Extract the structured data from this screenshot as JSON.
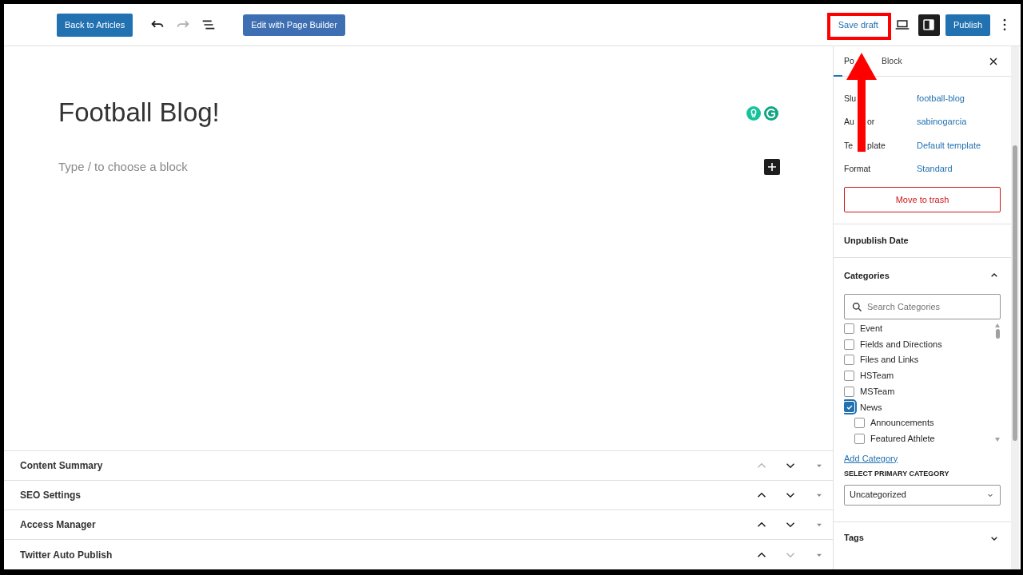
{
  "toolbar": {
    "back_button": "Back to Articles",
    "undo_enabled": true,
    "redo_enabled": false,
    "builder_button": "Edit with Page Builder",
    "save_draft": "Save draft",
    "settings_active": true,
    "publish": "Publish"
  },
  "editor": {
    "title": "Football Blog!",
    "placeholder": "Type / to choose a block"
  },
  "meta_boxes": [
    {
      "title": "Content Summary",
      "up_enabled": false,
      "down_enabled": true
    },
    {
      "title": "SEO Settings",
      "up_enabled": true,
      "down_enabled": true
    },
    {
      "title": "Access Manager",
      "up_enabled": true,
      "down_enabled": true
    },
    {
      "title": "Twitter Auto Publish",
      "up_enabled": true,
      "down_enabled": false
    }
  ],
  "sidebar": {
    "tabs": [
      {
        "label": "Po",
        "selected": true
      },
      {
        "label": "Block",
        "selected": false
      }
    ],
    "fields": [
      {
        "label": "Slu",
        "value": "football-blog"
      },
      {
        "label": "Au",
        "label_tail": "or",
        "value": "sabinogarcia"
      },
      {
        "label": "Te",
        "label_tail": "plate",
        "value": "Default template"
      },
      {
        "label": "Format",
        "value": "Standard"
      }
    ],
    "trash_button": "Move to trash",
    "unpublish_title": "Unpublish Date",
    "categories": {
      "title": "Categories",
      "expanded": true,
      "search_placeholder": "Search Categories",
      "items": [
        {
          "label": "Event",
          "checked": false
        },
        {
          "label": "Fields and Directions",
          "checked": false
        },
        {
          "label": "Files and Links",
          "checked": false
        },
        {
          "label": "HSTeam",
          "checked": false
        },
        {
          "label": "MSTeam",
          "checked": false
        },
        {
          "label": "News",
          "checked": true,
          "children": [
            {
              "label": "Announcements",
              "checked": false
            },
            {
              "label": "Featured Athlete",
              "checked": false
            }
          ]
        }
      ],
      "add_link": "Add Category",
      "primary_label": "SELECT PRIMARY CATEGORY",
      "primary_value": "Uncategorized"
    },
    "tags": {
      "title": "Tags",
      "expanded": false
    }
  }
}
